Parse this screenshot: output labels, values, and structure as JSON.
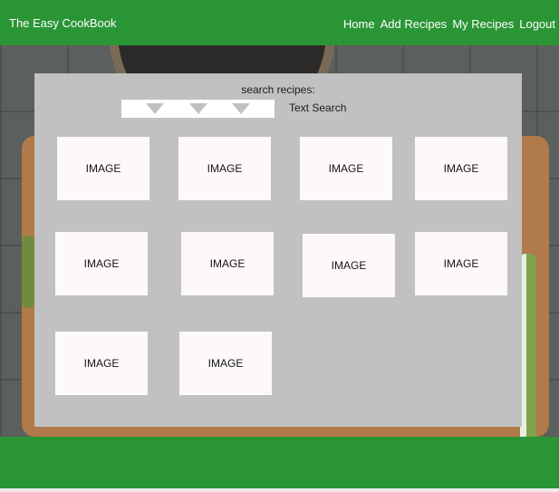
{
  "header": {
    "brand": "The Easy CookBook",
    "nav": [
      "Home",
      "Add Recipes",
      "My Recipes",
      "Logout"
    ]
  },
  "search": {
    "label": "search recipes:",
    "filters": [
      "dropdown-1",
      "dropdown-2",
      "dropdown-3"
    ],
    "text_search_label": "Text Search"
  },
  "grid": {
    "items": [
      "IMAGE",
      "IMAGE",
      "IMAGE",
      "IMAGE",
      "IMAGE",
      "IMAGE",
      "IMAGE",
      "IMAGE",
      "IMAGE",
      "IMAGE"
    ]
  },
  "colors": {
    "brand_green": "#2a9535",
    "panel_gray": "#c1c1c1",
    "card_bg": "#fdf9f8"
  }
}
